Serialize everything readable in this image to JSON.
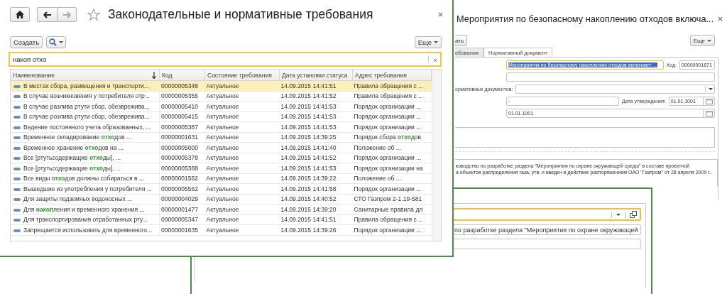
{
  "main_window": {
    "title": "Законодательные и нормативные требования",
    "favorite": false,
    "create_button": "Создать",
    "more_button": "Еще",
    "search": {
      "value": "накоп отхо"
    },
    "table": {
      "columns": [
        {
          "label": "Наименование",
          "sorted": true
        },
        {
          "label": "Код",
          "sorted": false
        },
        {
          "label": "Состояние требования",
          "sorted": false
        },
        {
          "label": "Дата установки статуса",
          "sorted": false
        },
        {
          "label": "Адрес требования",
          "sorted": false
        }
      ],
      "rows": [
        {
          "name": "В местах сбора, размещения и транспорти...",
          "code": "00000005348",
          "status": "Актуальное",
          "date": "14.09.2015 14:41:51",
          "address": "Правила обращения с ...",
          "selected": true
        },
        {
          "name": "В случае возникновения у потребителя отр...",
          "code": "00000005355",
          "status": "Актуальное",
          "date": "14.09.2015 14:41:52",
          "address": "Правила обращения с ...",
          "selected": false
        },
        {
          "name": "В случае разлива ртути сбор, обезврежива...",
          "code": "00000005410",
          "status": "Актуальное",
          "date": "14.09.2015 14:41:53",
          "address": "Порядок организации ...",
          "selected": false
        },
        {
          "name": "В случае розлива ртути сбор, обезврежива...",
          "code": "00000005415",
          "status": "Актуальное",
          "date": "14.09.2015 14:41:53",
          "address": "Порядок организации ...",
          "selected": false
        },
        {
          "name": "Ведение постоянного учета образованных, ...",
          "code": "00000005387",
          "status": "Актуальное",
          "date": "14.09.2015 14:41:53",
          "address": "Порядок организации ...",
          "selected": false
        },
        {
          "name": "Временное складирование **отхо**дов ...",
          "code": "00000001631",
          "status": "Актуальное",
          "date": "14.09.2015 14:39:25",
          "address": "Порядок сбора **отхо**дов",
          "selected": false
        },
        {
          "name": "Временное хранение **отхо**дов на ...",
          "code": "00000005000",
          "status": "Актуальное",
          "date": "14.09.2015 14:41:40",
          "address": "Положение об ...",
          "selected": false
        },
        {
          "name": "Все [ртутьсодержащие **отхо**ды], ...",
          "code": "00000005378",
          "status": "Актуальное",
          "date": "14.09.2015 14:41:52",
          "address": "Порядок организации ...",
          "selected": false
        },
        {
          "name": "Все [ртутьсодержащие **отхо**ды], ...",
          "code": "00000005388",
          "status": "Актуальное",
          "date": "14.09.2015 14:41:53",
          "address": "Порядок организации на",
          "selected": false
        },
        {
          "name": "Все виды **отхо**дов должны собираться в ...",
          "code": "00000001562",
          "status": "Актуальное",
          "date": "14.09.2015 14:39:22",
          "address": "Положение об ...",
          "selected": false
        },
        {
          "name": "Вышедшие из употребления у потребителя ...",
          "code": "00000005562",
          "status": "Актуальное",
          "date": "14.09.2015 14:41:58",
          "address": "Порядок организации ...",
          "selected": false
        },
        {
          "name": "Для защиты подземных водоносных ...",
          "code": "00000004029",
          "status": "Актуальное",
          "date": "14.09.2015 14:40:52",
          "address": "СТО Газпром 2-1.19-581",
          "selected": false
        },
        {
          "name": "Для **накоп**ления и временного хранения ...",
          "code": "00000001477",
          "status": "Актуальное",
          "date": "14.09.2015 14:39:20",
          "address": "Санитарные правила дл",
          "selected": false
        },
        {
          "name": "Для транспортирования отработанных рту...",
          "code": "00000005347",
          "status": "Актуальное",
          "date": "14.09.2015 14:41:51",
          "address": "Правила обращения с ...",
          "selected": false
        },
        {
          "name": "Запрещается использовать для временного...",
          "code": "00000001635",
          "status": "Актуальное",
          "date": "14.09.2015 14:39:26",
          "address": "Порядок организации ...",
          "selected": false
        }
      ]
    }
  },
  "back_window": {
    "title": "Мероприятия по безопасному накоплению отходов включа...",
    "button_fragment": "ать",
    "more_button": "Еще",
    "tabs": [
      {
        "label": "ебования",
        "selected": false
      },
      {
        "label": "Нормативный документ",
        "selected": true
      }
    ],
    "name_field": {
      "value": "Мероприятия по безопасному накоплению отходов включают: ...",
      "text_selected": true
    },
    "code_label": "Код:",
    "code_value": "00000001671",
    "documents_label": "ормативных документов:",
    "dash_field": "-",
    "approval_label": "Дата утверждения:",
    "approval_date": "01.01.1001",
    "date_field": "01.01.1001",
    "description_lines": [
      "ководство по разработке раздела \"Мероприятия по охране окружающей среды\" в составе проектной",
      "а объектов распределения газа, утв. и введен в действие распоряжением ОАО \"Газпром\" от 28 апреля 2009 г.."
    ]
  },
  "lower_window": {
    "document_field": "по разработке раздела \"Мероприятия по охране окружающей"
  }
}
